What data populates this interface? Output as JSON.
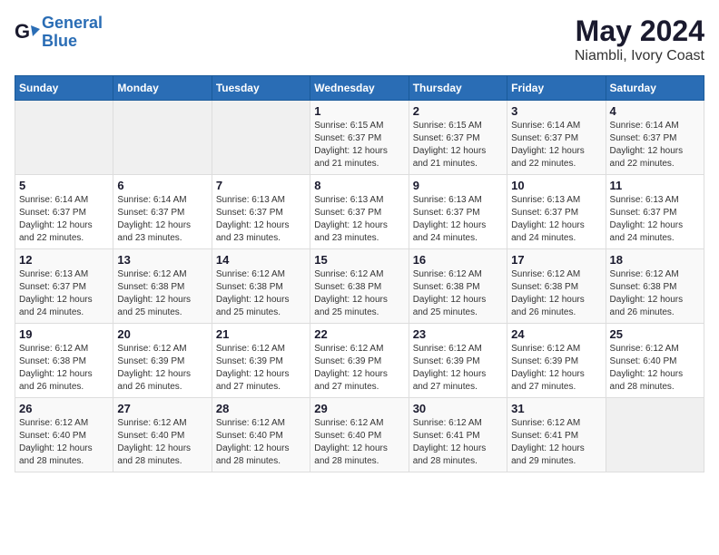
{
  "header": {
    "logo_line1": "General",
    "logo_line2": "Blue",
    "month": "May 2024",
    "location": "Niambli, Ivory Coast"
  },
  "weekdays": [
    "Sunday",
    "Monday",
    "Tuesday",
    "Wednesday",
    "Thursday",
    "Friday",
    "Saturday"
  ],
  "weeks": [
    [
      {
        "day": "",
        "info": ""
      },
      {
        "day": "",
        "info": ""
      },
      {
        "day": "",
        "info": ""
      },
      {
        "day": "1",
        "info": "Sunrise: 6:15 AM\nSunset: 6:37 PM\nDaylight: 12 hours\nand 21 minutes."
      },
      {
        "day": "2",
        "info": "Sunrise: 6:15 AM\nSunset: 6:37 PM\nDaylight: 12 hours\nand 21 minutes."
      },
      {
        "day": "3",
        "info": "Sunrise: 6:14 AM\nSunset: 6:37 PM\nDaylight: 12 hours\nand 22 minutes."
      },
      {
        "day": "4",
        "info": "Sunrise: 6:14 AM\nSunset: 6:37 PM\nDaylight: 12 hours\nand 22 minutes."
      }
    ],
    [
      {
        "day": "5",
        "info": "Sunrise: 6:14 AM\nSunset: 6:37 PM\nDaylight: 12 hours\nand 22 minutes."
      },
      {
        "day": "6",
        "info": "Sunrise: 6:14 AM\nSunset: 6:37 PM\nDaylight: 12 hours\nand 23 minutes."
      },
      {
        "day": "7",
        "info": "Sunrise: 6:13 AM\nSunset: 6:37 PM\nDaylight: 12 hours\nand 23 minutes."
      },
      {
        "day": "8",
        "info": "Sunrise: 6:13 AM\nSunset: 6:37 PM\nDaylight: 12 hours\nand 23 minutes."
      },
      {
        "day": "9",
        "info": "Sunrise: 6:13 AM\nSunset: 6:37 PM\nDaylight: 12 hours\nand 24 minutes."
      },
      {
        "day": "10",
        "info": "Sunrise: 6:13 AM\nSunset: 6:37 PM\nDaylight: 12 hours\nand 24 minutes."
      },
      {
        "day": "11",
        "info": "Sunrise: 6:13 AM\nSunset: 6:37 PM\nDaylight: 12 hours\nand 24 minutes."
      }
    ],
    [
      {
        "day": "12",
        "info": "Sunrise: 6:13 AM\nSunset: 6:37 PM\nDaylight: 12 hours\nand 24 minutes."
      },
      {
        "day": "13",
        "info": "Sunrise: 6:12 AM\nSunset: 6:38 PM\nDaylight: 12 hours\nand 25 minutes."
      },
      {
        "day": "14",
        "info": "Sunrise: 6:12 AM\nSunset: 6:38 PM\nDaylight: 12 hours\nand 25 minutes."
      },
      {
        "day": "15",
        "info": "Sunrise: 6:12 AM\nSunset: 6:38 PM\nDaylight: 12 hours\nand 25 minutes."
      },
      {
        "day": "16",
        "info": "Sunrise: 6:12 AM\nSunset: 6:38 PM\nDaylight: 12 hours\nand 25 minutes."
      },
      {
        "day": "17",
        "info": "Sunrise: 6:12 AM\nSunset: 6:38 PM\nDaylight: 12 hours\nand 26 minutes."
      },
      {
        "day": "18",
        "info": "Sunrise: 6:12 AM\nSunset: 6:38 PM\nDaylight: 12 hours\nand 26 minutes."
      }
    ],
    [
      {
        "day": "19",
        "info": "Sunrise: 6:12 AM\nSunset: 6:38 PM\nDaylight: 12 hours\nand 26 minutes."
      },
      {
        "day": "20",
        "info": "Sunrise: 6:12 AM\nSunset: 6:39 PM\nDaylight: 12 hours\nand 26 minutes."
      },
      {
        "day": "21",
        "info": "Sunrise: 6:12 AM\nSunset: 6:39 PM\nDaylight: 12 hours\nand 27 minutes."
      },
      {
        "day": "22",
        "info": "Sunrise: 6:12 AM\nSunset: 6:39 PM\nDaylight: 12 hours\nand 27 minutes."
      },
      {
        "day": "23",
        "info": "Sunrise: 6:12 AM\nSunset: 6:39 PM\nDaylight: 12 hours\nand 27 minutes."
      },
      {
        "day": "24",
        "info": "Sunrise: 6:12 AM\nSunset: 6:39 PM\nDaylight: 12 hours\nand 27 minutes."
      },
      {
        "day": "25",
        "info": "Sunrise: 6:12 AM\nSunset: 6:40 PM\nDaylight: 12 hours\nand 28 minutes."
      }
    ],
    [
      {
        "day": "26",
        "info": "Sunrise: 6:12 AM\nSunset: 6:40 PM\nDaylight: 12 hours\nand 28 minutes."
      },
      {
        "day": "27",
        "info": "Sunrise: 6:12 AM\nSunset: 6:40 PM\nDaylight: 12 hours\nand 28 minutes."
      },
      {
        "day": "28",
        "info": "Sunrise: 6:12 AM\nSunset: 6:40 PM\nDaylight: 12 hours\nand 28 minutes."
      },
      {
        "day": "29",
        "info": "Sunrise: 6:12 AM\nSunset: 6:40 PM\nDaylight: 12 hours\nand 28 minutes."
      },
      {
        "day": "30",
        "info": "Sunrise: 6:12 AM\nSunset: 6:41 PM\nDaylight: 12 hours\nand 28 minutes."
      },
      {
        "day": "31",
        "info": "Sunrise: 6:12 AM\nSunset: 6:41 PM\nDaylight: 12 hours\nand 29 minutes."
      },
      {
        "day": "",
        "info": ""
      }
    ]
  ]
}
